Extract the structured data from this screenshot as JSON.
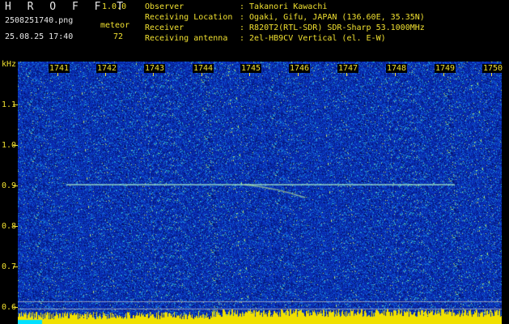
{
  "app": {
    "name": "H R O F F T",
    "version": "1.0.0",
    "filename": "2508251740.png",
    "datetime": "25.08.25 17:40",
    "meteor_label": "meteor",
    "meteor_count": "72"
  },
  "info": [
    {
      "label": "Observer",
      "value": ": Takanori Kawachi"
    },
    {
      "label": "Receiving Location",
      "value": ": Ogaki, Gifu, JAPAN (136.60E, 35.35N)"
    },
    {
      "label": "Receiver",
      "value": ": R820T2(RTL-SDR) SDR-Sharp 53.1000MHz"
    },
    {
      "label": "Receiving antenna",
      "value": ": 2el-HB9CV Vertical (el. E-W)"
    }
  ],
  "axis": {
    "y_unit": "kHz",
    "y_ticks": [
      "1.1",
      "1.0",
      "0.9",
      "0.8",
      "0.7",
      "0.6"
    ],
    "x_ticks": [
      "1741",
      "1742",
      "1743",
      "1744",
      "1745",
      "1746",
      "1747",
      "1748",
      "1749",
      "1750"
    ]
  },
  "colors": {
    "background": "#000000",
    "text_yellow": "#f0e030",
    "spectrogram_base": "#0a2fb8",
    "noise_floor": "#f0e000"
  }
}
